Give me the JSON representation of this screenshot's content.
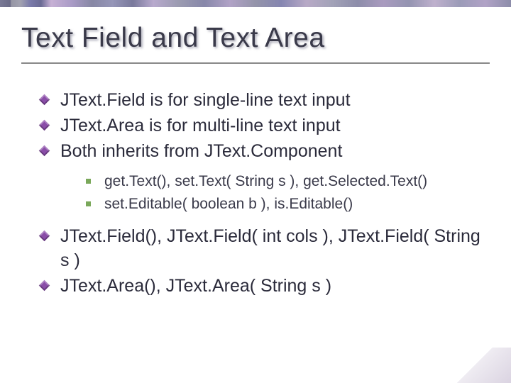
{
  "slide": {
    "title": "Text Field and Text Area",
    "bullets": [
      {
        "text": "JText.Field is for single-line text input"
      },
      {
        "text": "JText.Area is for multi-line text input"
      },
      {
        "text": "Both inherits from JText.Component"
      }
    ],
    "sub_bullets": [
      {
        "text": "get.Text(), set.Text( String s ), get.Selected.Text()"
      },
      {
        "text": "set.Editable( boolean b ), is.Editable()"
      }
    ],
    "bullets2": [
      {
        "text": "JText.Field(), JText.Field( int cols ), JText.Field( String s )"
      },
      {
        "text": "JText.Area(), JText.Area( String s )"
      }
    ]
  }
}
